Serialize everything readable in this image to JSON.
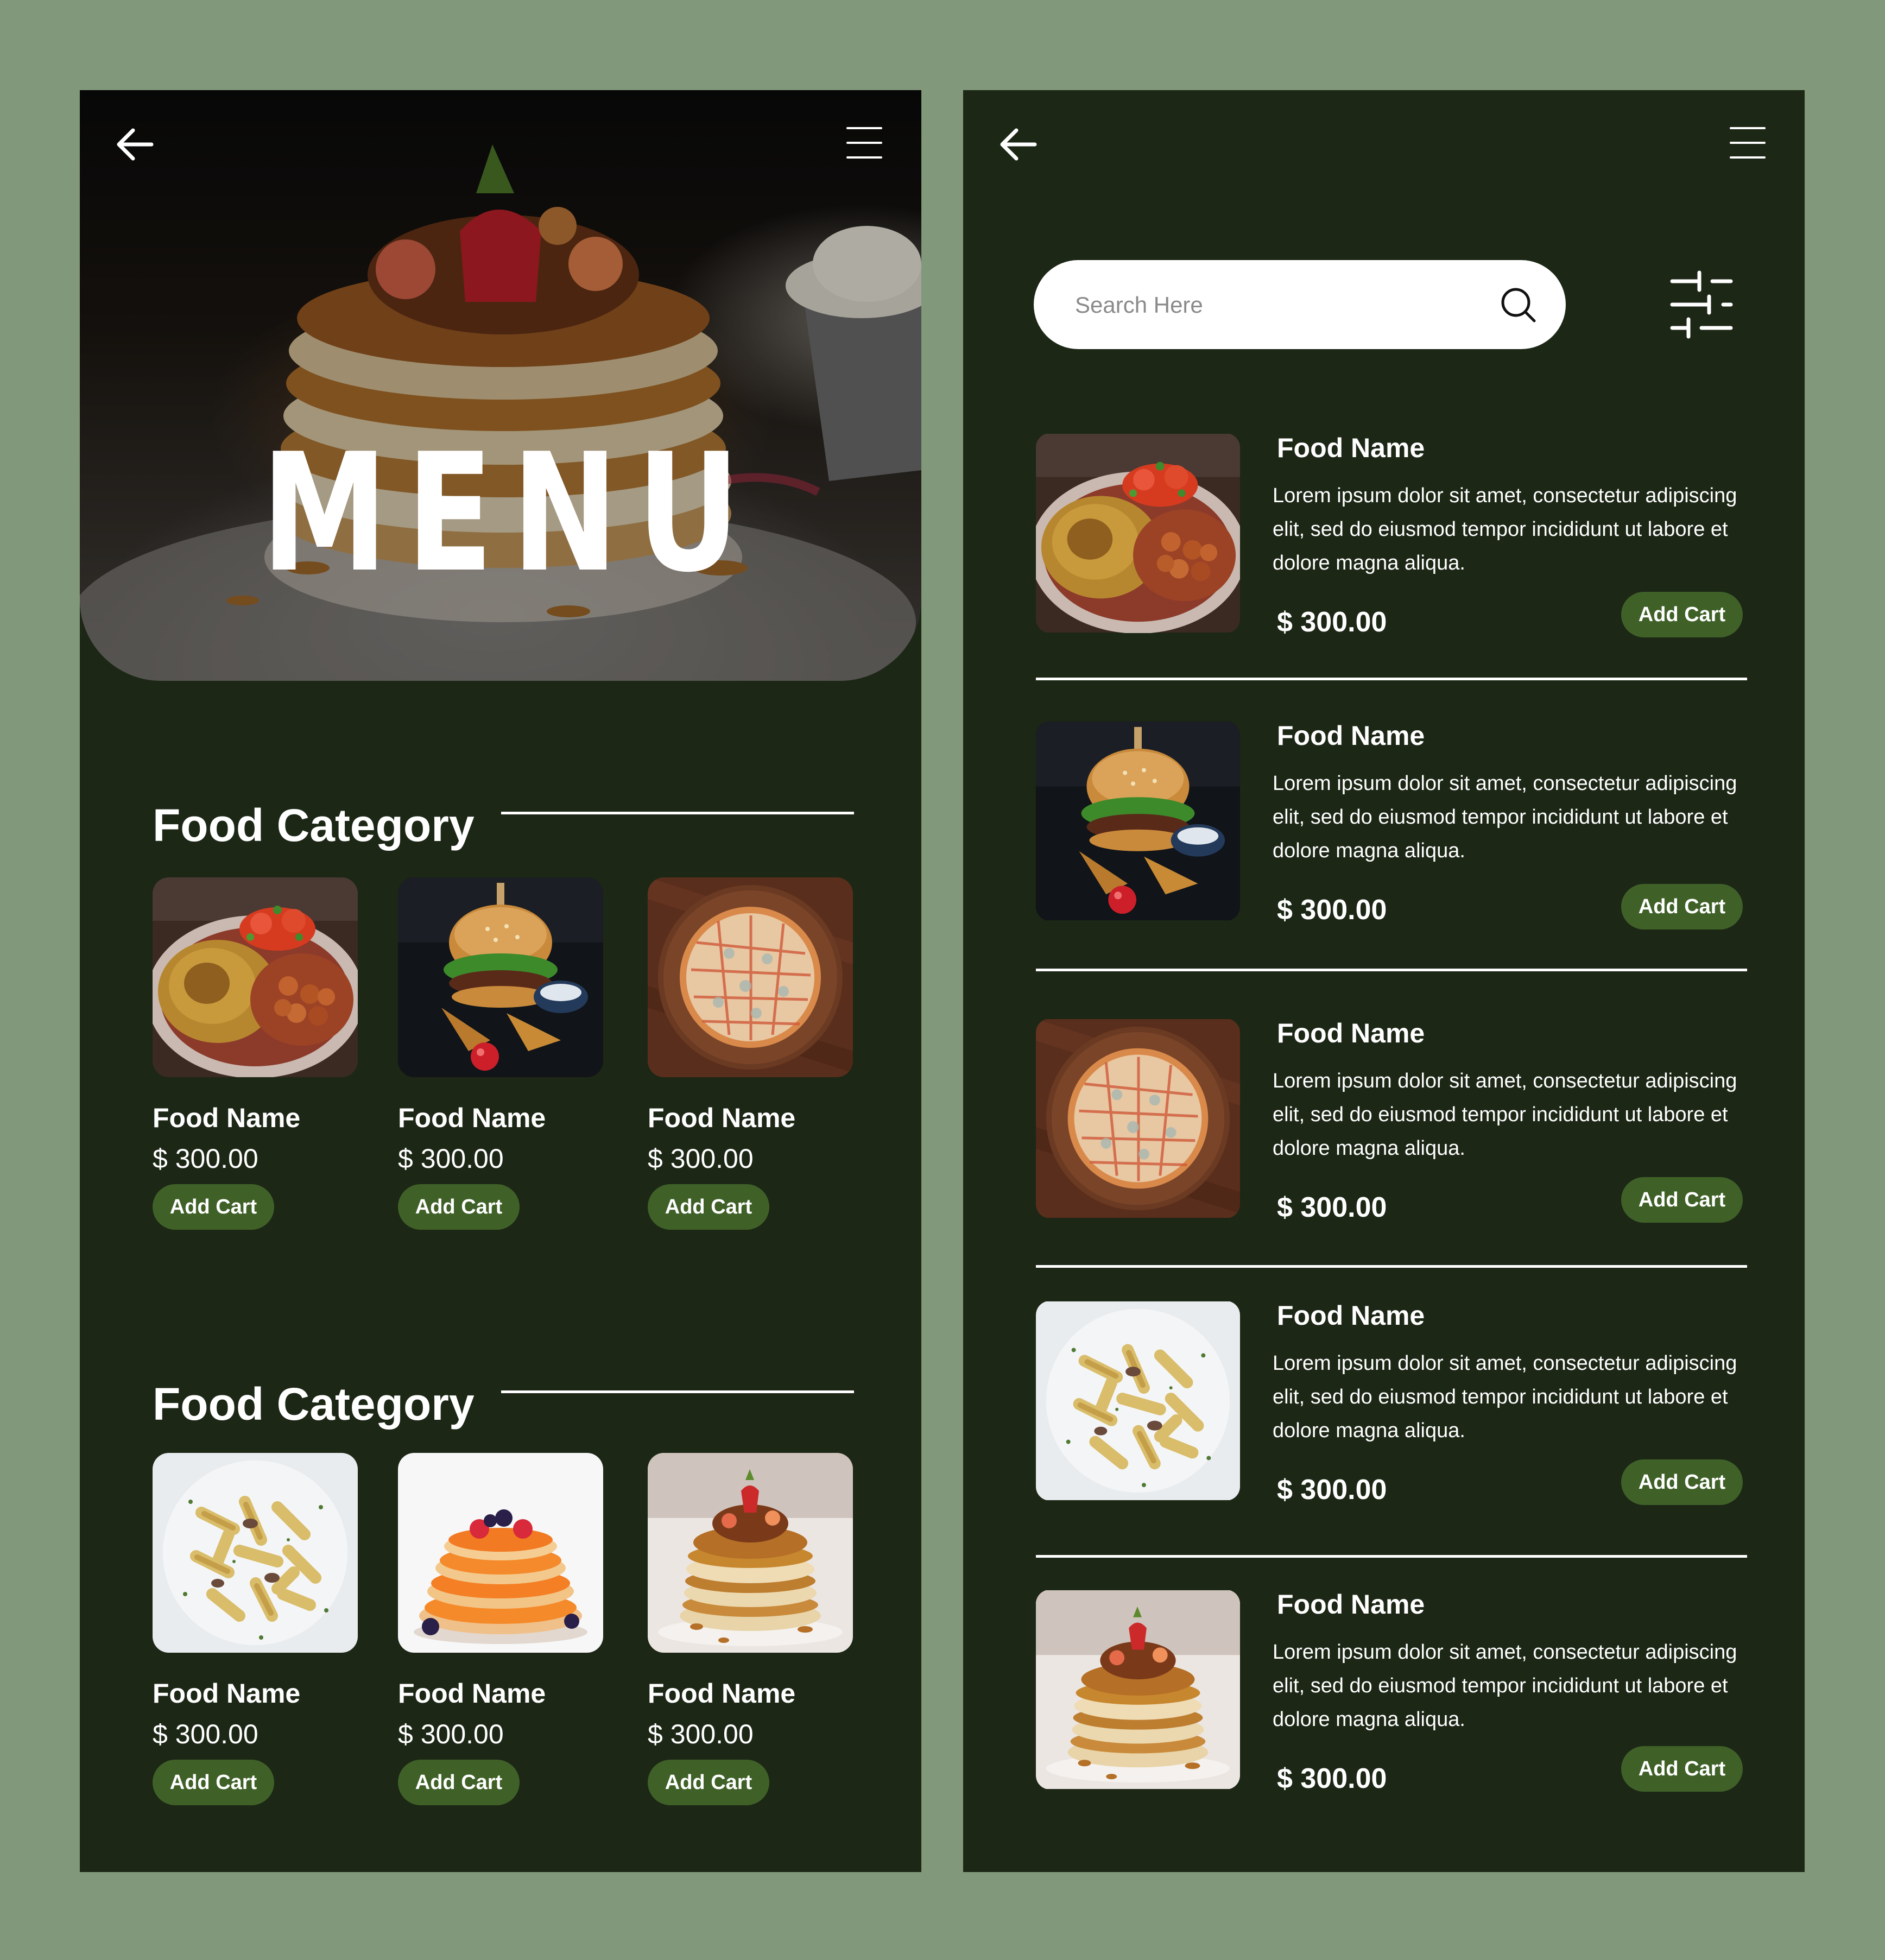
{
  "left_screen": {
    "hero": {
      "title": "MENU"
    },
    "categories": [
      {
        "title": "Food Category",
        "items": [
          {
            "name": "Food Name",
            "price": "$ 300.00",
            "button": "Add Cart"
          },
          {
            "name": "Food Name",
            "price": "$ 300.00",
            "button": "Add Cart"
          },
          {
            "name": "Food Name",
            "price": "$ 300.00",
            "button": "Add Cart"
          }
        ]
      },
      {
        "title": "Food Category",
        "items": [
          {
            "name": "Food Name",
            "price": "$ 300.00",
            "button": "Add Cart"
          },
          {
            "name": "Food Name",
            "price": "$ 300.00",
            "button": "Add Cart"
          },
          {
            "name": "Food Name",
            "price": "$ 300.00",
            "button": "Add Cart"
          }
        ]
      }
    ]
  },
  "right_screen": {
    "search": {
      "placeholder": "Search Here"
    },
    "items": [
      {
        "name": "Food Name",
        "description": "Lorem ipsum dolor sit amet, consectetur adipiscing elit, sed do eiusmod tempor incididunt ut labore et dolore magna aliqua.",
        "price": "$ 300.00",
        "button": "Add Cart"
      },
      {
        "name": "Food Name",
        "description": "Lorem ipsum dolor sit amet, consectetur adipiscing elit, sed do eiusmod tempor incididunt ut labore et dolore magna aliqua.",
        "price": "$ 300.00",
        "button": "Add Cart"
      },
      {
        "name": "Food Name",
        "description": "Lorem ipsum dolor sit amet, consectetur adipiscing elit, sed do eiusmod tempor incididunt ut labore et dolore magna aliqua.",
        "price": "$ 300.00",
        "button": "Add Cart"
      },
      {
        "name": "Food Name",
        "description": "Lorem ipsum dolor sit amet, consectetur adipiscing elit, sed do eiusmod tempor incididunt ut labore et dolore magna aliqua.",
        "price": "$ 300.00",
        "button": "Add Cart"
      },
      {
        "name": "Food Name",
        "description": "Lorem ipsum dolor sit amet, consectetur adipiscing elit, sed do eiusmod tempor incididunt ut labore et dolore magna aliqua.",
        "price": "$ 300.00",
        "button": "Add Cart"
      }
    ]
  },
  "icons": {
    "back": "back-arrow-icon",
    "menu": "hamburger-menu-icon",
    "search": "search-icon",
    "filter": "filter-sliders-icon"
  },
  "colors": {
    "page_background": "#82987a",
    "screen_background": "#1c2716",
    "button": "#3f6128",
    "text": "#ffffff"
  }
}
